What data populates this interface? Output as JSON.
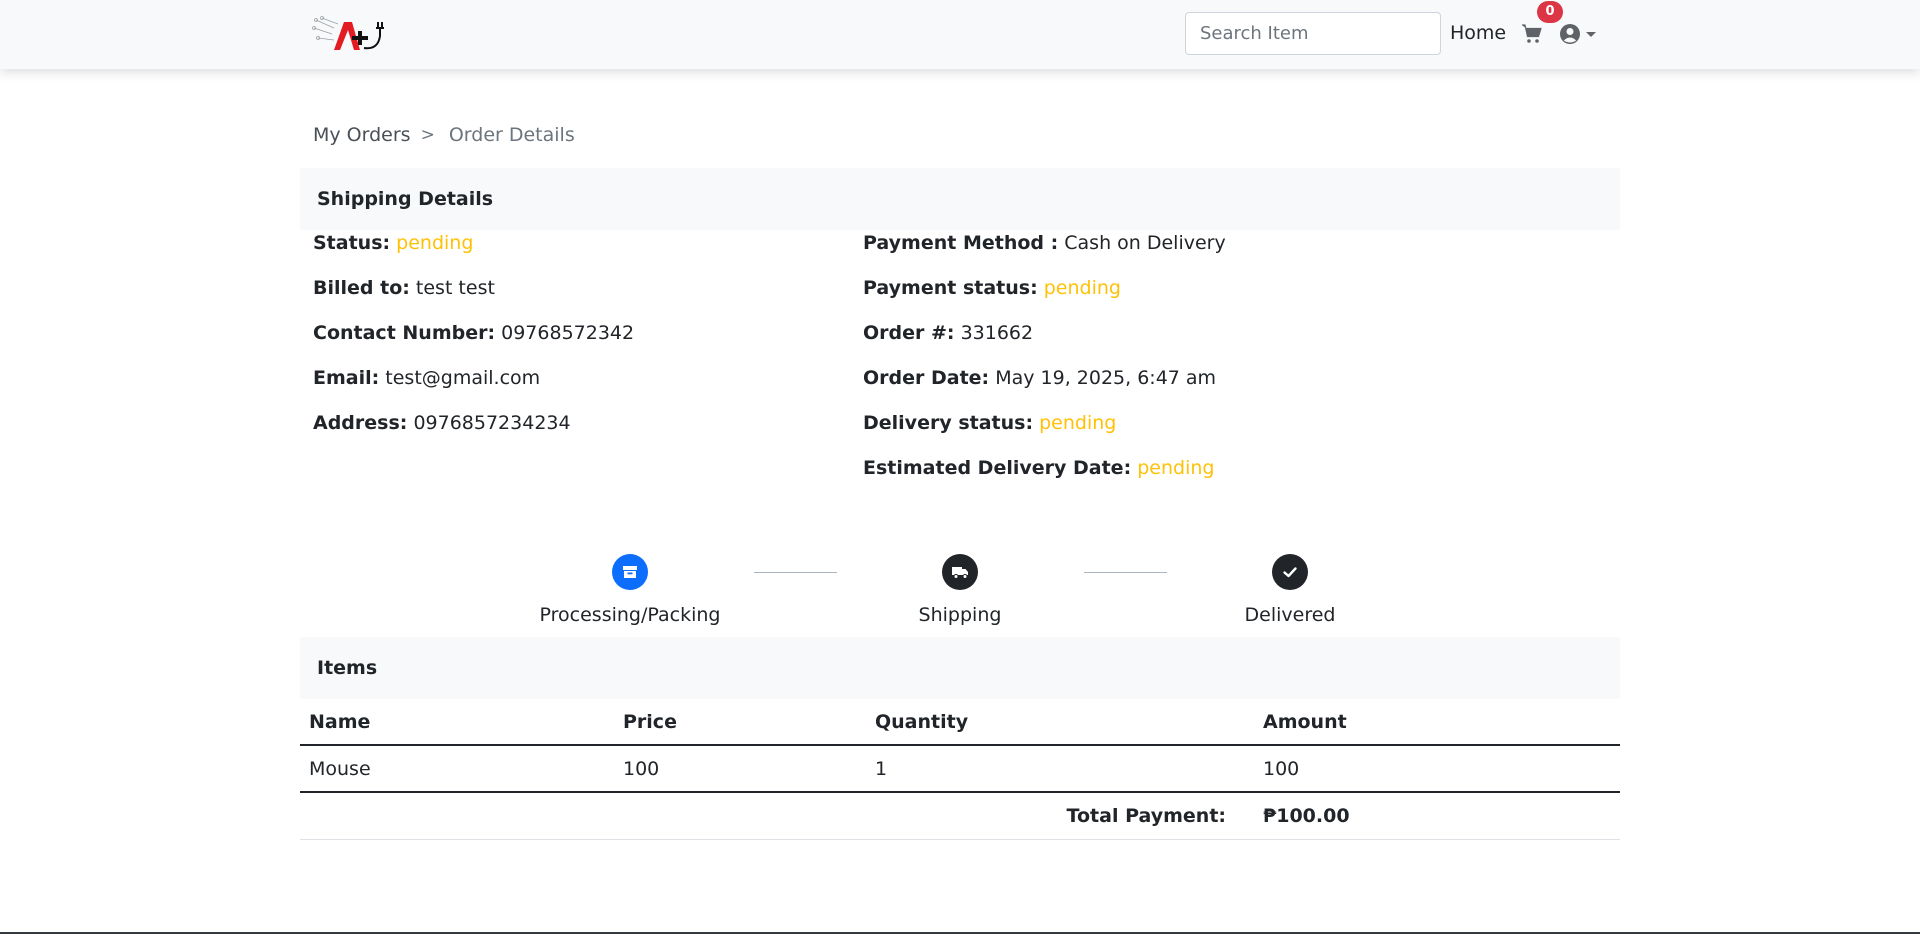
{
  "nav": {
    "search_placeholder": "Search Item",
    "home_label": "Home",
    "cart_count": "0",
    "cart_icon": "shopping-cart-icon",
    "user_icon": "user-circle-icon"
  },
  "breadcrumb": {
    "parent": "My Orders",
    "separator": ">",
    "current": "Order Details"
  },
  "shipping": {
    "header": "Shipping Details",
    "left": [
      {
        "label": "Status:",
        "value": "pending",
        "highlight": true
      },
      {
        "label": "Billed to:",
        "value": "test test",
        "highlight": false
      },
      {
        "label": "Contact Number:",
        "value": "09768572342",
        "highlight": false
      },
      {
        "label": "Email:",
        "value": "test@gmail.com",
        "highlight": false
      },
      {
        "label": "Address:",
        "value": "0976857234234",
        "highlight": false
      }
    ],
    "right": [
      {
        "label": "Payment Method :",
        "value": "Cash on Delivery",
        "highlight": false
      },
      {
        "label": "Payment status:",
        "value": "pending",
        "highlight": true
      },
      {
        "label": "Order #:",
        "value": "331662",
        "highlight": false
      },
      {
        "label": "Order Date:",
        "value": "May 19, 2025, 6:47 am",
        "highlight": false
      },
      {
        "label": "Delivery status:",
        "value": "pending",
        "highlight": true
      },
      {
        "label": "Estimated Delivery Date:",
        "value": "pending",
        "highlight": true
      }
    ]
  },
  "progress": {
    "steps": [
      {
        "label": "Processing/Packing",
        "icon": "box-icon",
        "active": true
      },
      {
        "label": "Shipping",
        "icon": "truck-icon",
        "active": false
      },
      {
        "label": "Delivered",
        "icon": "check-icon",
        "active": false
      }
    ]
  },
  "items": {
    "header": "Items",
    "columns": [
      "Name",
      "Price",
      "Quantity",
      "Amount"
    ],
    "rows": [
      [
        "Mouse",
        "100",
        "1",
        "100"
      ]
    ],
    "total_label": "Total Payment:",
    "total_value": "₱100.00"
  },
  "colors": {
    "pending": "#ffc107",
    "active_step": "#0d6efd",
    "inactive_step": "#212529",
    "badge": "#dc3545"
  }
}
